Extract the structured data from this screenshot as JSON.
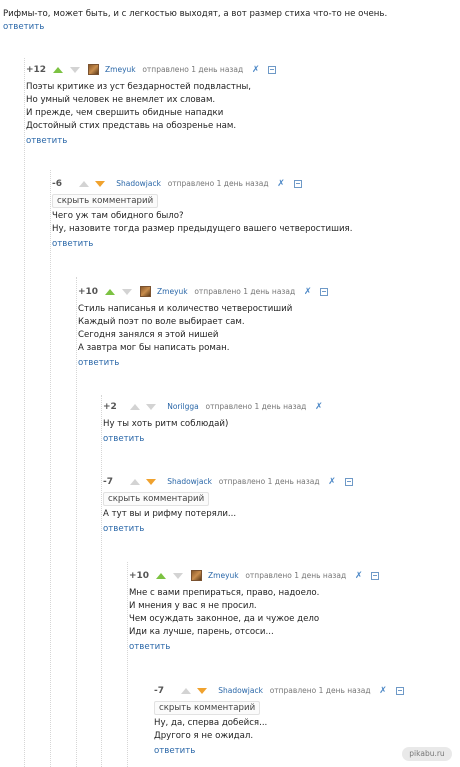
{
  "intro": {
    "text": "Рифмы-то, может быть, и с легкостью выходят, а вот размер стиха что-то не очень.",
    "reply": "ответить"
  },
  "comments": [
    {
      "rating": "+12",
      "user": "Zmeyuk",
      "meta": "отправлено 1 день назад",
      "lines": [
        "Поэты критике из уст бездарностей подвластны,",
        "Но умный человек не внемлет их словам.",
        "И прежде, чем свершить обидные нападки",
        "Достойный стих представь на обозренье нам."
      ],
      "reply": "ответить"
    },
    {
      "rating": "-6",
      "user": "Shadowjack",
      "meta": "отправлено 1 день назад",
      "hide": "скрыть комментарий",
      "lines": [
        "Чего уж там обидного было?",
        "Ну, назовите тогда размер предыдущего вашего четверостишия."
      ],
      "reply": "ответить"
    },
    {
      "rating": "+10",
      "user": "Zmeyuk",
      "meta": "отправлено 1 день назад",
      "lines": [
        "Стиль написанья и количество четверостиший",
        "Каждый поэт по воле выбирает сам.",
        "Сегодня занялся я этой нишей",
        "А завтра мог бы написать роман."
      ],
      "reply": "ответить"
    },
    {
      "rating": "+2",
      "user": "Norilgga",
      "meta": "отправлено 1 день назад",
      "lines": [
        "Ну ты хоть ритм соблюдай)"
      ],
      "reply": "ответить"
    },
    {
      "rating": "-7",
      "user": "Shadowjack",
      "meta": "отправлено 1 день назад",
      "hide": "скрыть комментарий",
      "lines": [
        "А тут вы и рифму потеряли..."
      ],
      "reply": "ответить"
    },
    {
      "rating": "+10",
      "user": "Zmeyuk",
      "meta": "отправлено 1 день назад",
      "lines": [
        "Мне с вами препираться, право, надоело.",
        "И мнения у вас я не просил.",
        "Чем осуждать законное, да и чужое дело",
        "Иди ка лучше, парень, отсоси..."
      ],
      "reply": "ответить"
    },
    {
      "rating": "-7",
      "user": "Shadowjack",
      "meta": "отправлено 1 день назад",
      "hide": "скрыть комментарий",
      "lines": [
        "Ну, да, сперва добейся...",
        "Другого я не ожидал."
      ],
      "reply": "ответить"
    }
  ],
  "watermark": "pikabu.ru",
  "colors": {
    "link": "#2a67a8",
    "up": "#7cc242",
    "down": "#f0a22e"
  }
}
